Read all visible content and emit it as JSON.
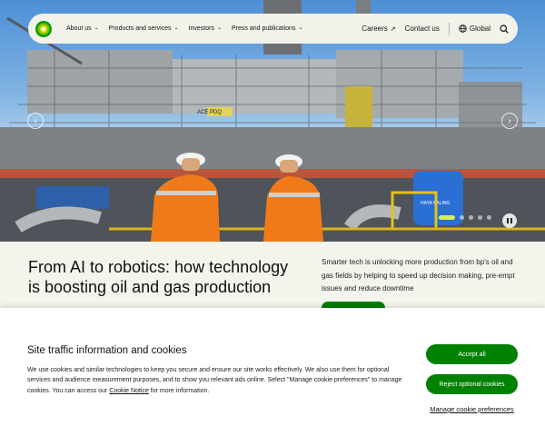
{
  "nav": {
    "links": [
      {
        "label": "About us"
      },
      {
        "label": "Products and services"
      },
      {
        "label": "Investors"
      },
      {
        "label": "Press and publications"
      }
    ],
    "careers_label": "Careers",
    "contact_label": "Contact us",
    "global_label": "Global",
    "icons": {
      "logo": "bp-helios-logo",
      "careers": "external-link-icon",
      "global": "globe-icon",
      "search": "search-icon"
    }
  },
  "hero": {
    "sign_text": "ACE PDQ",
    "ship_text": "HAYA BALING",
    "carousel": {
      "slides": 5,
      "active": 1
    }
  },
  "article": {
    "headline": "From AI to robotics: how technology is boosting oil and gas production",
    "summary": "Smarter tech is unlocking more production from bp's oil and gas fields by helping to speed up decision making, pre-empt issues and reduce downtime"
  },
  "cookie": {
    "title": "Site traffic information and cookies",
    "body_before": "We use cookies and similar technologies to keep you secure and ensure our site works effectively. We also use them for optional services and audience measurement purposes, and to show you relevant ads online. Select \"Manage cookie preferences\" to manage cookies. You can access our ",
    "link_label": "Cookie Notice",
    "body_after": " for more information.",
    "accept_label": "Accept all",
    "reject_label": "Reject optional cookies",
    "manage_label": "Manage cookie preferences"
  },
  "colors": {
    "brand_green": "#008200",
    "nav_bg": "#f2f2ea",
    "accent_lime": "#d6f05a",
    "coverall_orange": "#f07a1a"
  }
}
